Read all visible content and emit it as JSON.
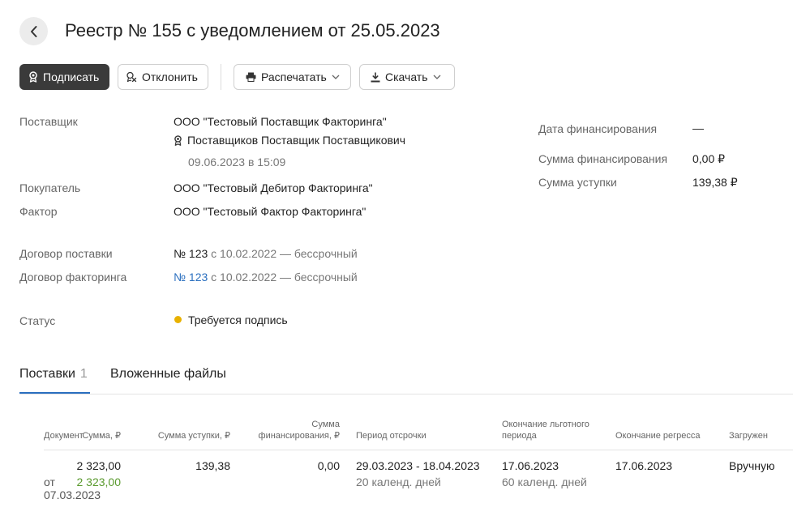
{
  "header": {
    "title": "Реестр № 155 с уведомлением от 25.05.2023"
  },
  "toolbar": {
    "sign_label": "Подписать",
    "reject_label": "Отклонить",
    "print_label": "Распечатать",
    "download_label": "Скачать"
  },
  "details": {
    "supplier": {
      "label": "Поставщик",
      "value": "ООО \"Тестовый Поставщик Факторинга\"",
      "signer": "Поставщиков Поставщик Поставщикович",
      "signed_at": "09.06.2023 в 15:09"
    },
    "buyer": {
      "label": "Покупатель",
      "value": "ООО \"Тестовый Дебитор Факторинга\""
    },
    "factor": {
      "label": "Фактор",
      "value": "ООО \"Тестовый Фактор Факторинга\""
    },
    "supply_contract": {
      "label": "Договор поставки",
      "number": "№ 123",
      "rest": "с 10.02.2022 — бессрочный"
    },
    "factoring_contract": {
      "label": "Договор факторинга",
      "number": "№ 123",
      "rest": "с 10.02.2022 — бессрочный"
    },
    "status": {
      "label": "Статус",
      "value": "Требуется подпись",
      "color": "#e8b100"
    }
  },
  "summary": {
    "financing_date": {
      "label": "Дата финансирования",
      "value": "—"
    },
    "financing_sum": {
      "label": "Сумма финансирования",
      "value": "0,00 ₽"
    },
    "assignment_sum": {
      "label": "Сумма уступки",
      "value": "139,38 ₽"
    }
  },
  "tabs": [
    {
      "label": "Поставки",
      "count": "1",
      "active": true
    },
    {
      "label": "Вложенные файлы"
    }
  ],
  "table": {
    "columns": {
      "document": "Документ",
      "sum": "Сумма, ₽",
      "assignment": "Сумма уступки, ₽",
      "financing_l1": "Сумма",
      "financing_l2": "финансирования, ₽",
      "period": "Период отсрочки",
      "grace_l1": "Окончание льготного",
      "grace_l2": "периода",
      "regress": "Окончание регресса",
      "loaded": "Загружен"
    },
    "rows": [
      {
        "doc_from": "от",
        "doc_date": "07.03.2023",
        "sum": "2 323,00",
        "sum_paid": "2 323,00",
        "assignment": "139,38",
        "financing": "0,00",
        "period": "29.03.2023 - 18.04.2023",
        "period_days": "20 календ. дней",
        "grace": "17.06.2023",
        "grace_days": "60 календ. дней",
        "regress": "17.06.2023",
        "loaded": "Вручную"
      }
    ]
  },
  "colors": {
    "primary_button": "#3a3a3a",
    "link": "#2a6fbf",
    "status_pending": "#e8b100",
    "paid_amount": "#5a9a2e"
  }
}
